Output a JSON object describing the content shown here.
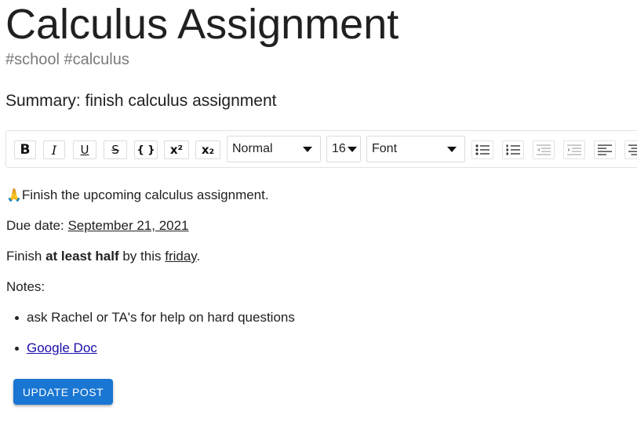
{
  "post": {
    "title": "Calculus Assignment",
    "tags": "#school #calculus",
    "summary": "Summary: finish calculus assignment"
  },
  "toolbar": {
    "bold": "B",
    "italic": "I",
    "underline": "U",
    "strike": "S",
    "code": "{ }",
    "superscript": "x²",
    "subscript": "x₂",
    "block_format": "Normal",
    "font_size": "16",
    "font_family": "Font",
    "icons": [
      "bullet-list-icon",
      "numbered-list-icon",
      "outdent-icon",
      "indent-icon",
      "align-left-icon",
      "align-center-icon"
    ]
  },
  "body": {
    "line1_emoji": "🙏",
    "line1_text": "Finish the upcoming calculus assignment.",
    "due_label": "Due date: ",
    "due_value": "September 21, 2021",
    "finish_prefix": "Finish ",
    "finish_bold": "at least half",
    "finish_mid": " by this ",
    "finish_day": "friday",
    "finish_end": ".",
    "notes_label": "Notes:",
    "bullet1": "ask Rachel or TA's for help on hard questions",
    "bullet2_link": "Google Doc"
  },
  "actions": {
    "update_label": "UPDATE POST"
  }
}
